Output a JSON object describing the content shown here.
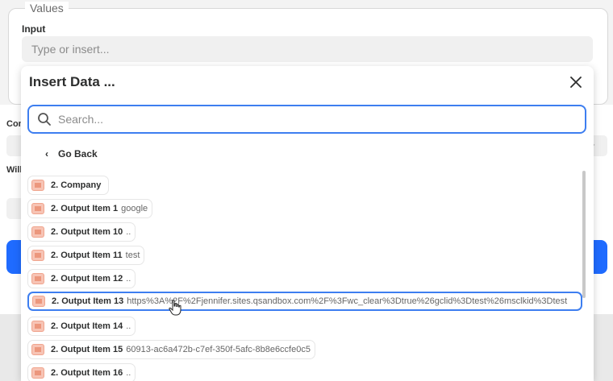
{
  "values": {
    "legend": "Values",
    "input_label": "Input",
    "input_placeholder": "Type or insert..."
  },
  "background": {
    "label_con": "Con",
    "label_will": "Will"
  },
  "modal": {
    "title": "Insert Data ...",
    "search_placeholder": "Search...",
    "go_back_label": "Go Back",
    "items": [
      {
        "label": "2. Company",
        "value": ""
      },
      {
        "label": "2. Output Item 1",
        "value": "google"
      },
      {
        "label": "2. Output Item 10",
        "value": ".."
      },
      {
        "label": "2. Output Item 11",
        "value": "test"
      },
      {
        "label": "2. Output Item 12",
        "value": ".."
      },
      {
        "label": "2. Output Item 13",
        "value": "https%3A%2F%2Fjennifer.sites.qsandbox.com%2F%3Fwc_clear%3Dtrue%26gclid%3Dtest%26msclkid%3Dtest"
      },
      {
        "label": "2. Output Item 14",
        "value": ".."
      },
      {
        "label": "2. Output Item 15",
        "value": "60913-ac6a472b-c7ef-350f-5afc-8b8e6ccfe0c5"
      },
      {
        "label": "2. Output Item 16",
        "value": ".."
      }
    ],
    "selected_index": 5
  },
  "colors": {
    "accent": "#3d7ef0",
    "primary_button": "#1f6bff",
    "item_icon": "#f7c4b5"
  }
}
